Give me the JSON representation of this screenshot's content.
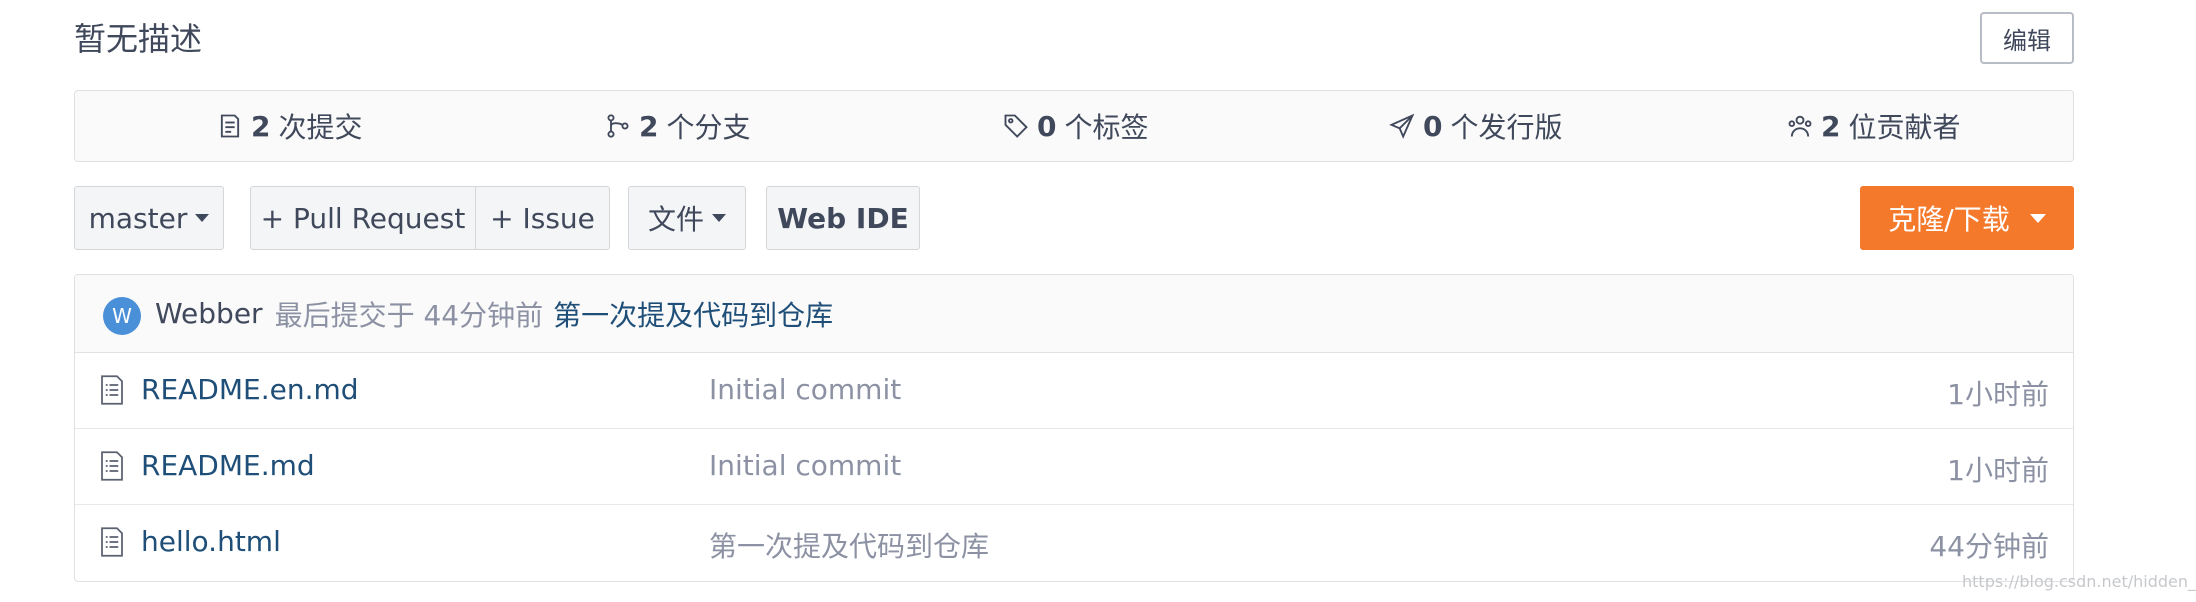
{
  "repo": {
    "description": "暂无描述",
    "edit_label": "编辑"
  },
  "stats": [
    {
      "icon": "commit-icon",
      "count": "2",
      "label": "次提交"
    },
    {
      "icon": "branch-icon",
      "count": "2",
      "label": "个分支"
    },
    {
      "icon": "tag-icon",
      "count": "0",
      "label": "个标签"
    },
    {
      "icon": "release-icon",
      "count": "0",
      "label": "个发行版"
    },
    {
      "icon": "contributors-icon",
      "count": "2",
      "label": "位贡献者"
    }
  ],
  "toolbar": {
    "branch_label": "master",
    "pull_request_label": "+ Pull Request",
    "issue_label": "+ Issue",
    "file_label": "文件",
    "web_ide_label": "Web IDE",
    "clone_label": "克隆/下载",
    "clone_color": "#f5792b"
  },
  "latest_commit": {
    "avatar_letter": "W",
    "author": "Webber",
    "meta": "最后提交于 44分钟前",
    "message": "第一次提及代码到仓库"
  },
  "files": [
    {
      "name": "README.en.md",
      "message": "Initial commit",
      "time": "1小时前"
    },
    {
      "name": "README.md",
      "message": "Initial commit",
      "time": "1小时前"
    },
    {
      "name": "hello.html",
      "message": "第一次提及代码到仓库",
      "time": "44分钟前"
    }
  ],
  "watermark": "https://blog.csdn.net/hidden_wb"
}
